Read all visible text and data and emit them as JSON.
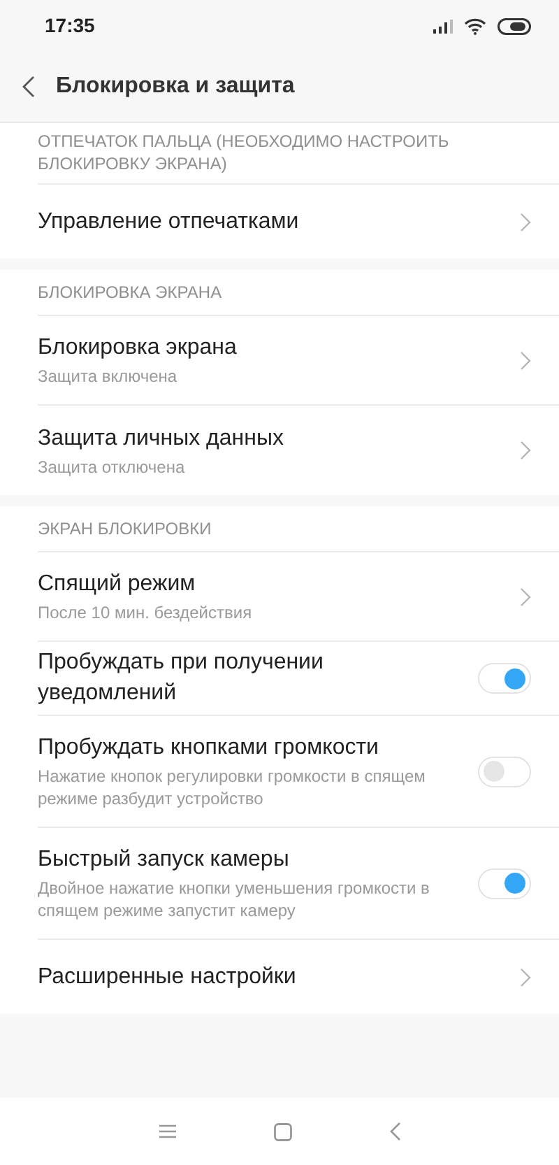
{
  "status_bar": {
    "time": "17:35"
  },
  "header": {
    "title": "Блокировка и защита"
  },
  "sections": [
    {
      "title": "ОТПЕЧАТОК ПАЛЬЦА (НЕОБХОДИМО НАСТРОИТЬ БЛОКИРОВКУ ЭКРАНА)",
      "items": [
        {
          "kind": "link",
          "label": "Управление отпечатками"
        }
      ]
    },
    {
      "title": "БЛОКИРОВКА ЭКРАНА",
      "items": [
        {
          "kind": "link",
          "label": "Блокировка экрана",
          "description": "Защита включена"
        },
        {
          "kind": "link",
          "label": "Защита личных данных",
          "description": "Защита отключена"
        }
      ]
    },
    {
      "title": "ЭКРАН БЛОКИРОВКИ",
      "items": [
        {
          "kind": "link",
          "label": "Спящий режим",
          "description": "После 10 мин. бездействия"
        },
        {
          "kind": "toggle",
          "label": "Пробуждать при получении уведомлений",
          "on": true
        },
        {
          "kind": "toggle",
          "label": "Пробуждать кнопками громкости",
          "description": "Нажатие кнопок регулировки громкости в спящем режиме разбудит устройство",
          "on": false
        },
        {
          "kind": "toggle",
          "label": "Быстрый запуск камеры",
          "description": "Двойное нажатие кнопки уменьшения громкости в спящем режиме запустит камеру",
          "on": true
        },
        {
          "kind": "link",
          "label": "Расширенные настройки"
        }
      ]
    }
  ]
}
